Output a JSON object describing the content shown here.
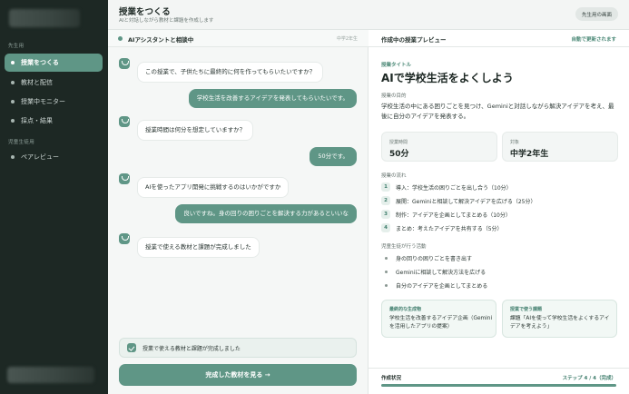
{
  "sidebar": {
    "section_teacher": "先生用",
    "items": [
      {
        "label": "授業をつくる",
        "active": true
      },
      {
        "label": "教材と配信"
      },
      {
        "label": "授業中モニター"
      },
      {
        "label": "採点・結果"
      }
    ],
    "section_student": "児童生徒用",
    "student_items": [
      {
        "label": "ペアレビュー"
      }
    ]
  },
  "header": {
    "title": "授業をつくる",
    "subtitle": "AIと対話しながら教材と課題を作成します",
    "button": "先生用の画面"
  },
  "chat": {
    "title": "AIアシスタントと相談中",
    "meta": "中学2年生",
    "messages": [
      {
        "role": "ai",
        "text": "この授業で、子供たちに最終的に何を作ってもらいたいですか？"
      },
      {
        "role": "user",
        "text": "学校生活を改善するアイデアを発表してもらいたいです。"
      },
      {
        "role": "ai",
        "text": "授業時間は何分を想定していますか？"
      },
      {
        "role": "user",
        "text": "50分です。"
      },
      {
        "role": "ai",
        "text": "AIを使ったアプリ開発に挑戦するのはいかがですか"
      },
      {
        "role": "user",
        "text": "良いですね。身の回りの困りごとを解決する力があるといいな"
      },
      {
        "role": "ai",
        "text": "授業で使える教材と課題が完成しました"
      }
    ],
    "notice": "授業で使える教材と課題が完成しました",
    "cta": "完成した教材を見る →"
  },
  "preview": {
    "title": "作成中の授業プレビュー",
    "auto_save": "自動で更新されます",
    "lesson_title_label": "授業タイトル",
    "lesson_title": "AIで学校生活をよくしよう",
    "goal_label": "授業の目的",
    "goal": "学校生活の中にある困りごとを見つけ、Geminiと対話しながら解決アイデアを考え、最後に自分のアイデアを発表する。",
    "stats": [
      {
        "label": "授業時間",
        "value": "50分"
      },
      {
        "label": "対象",
        "value": "中学2年生"
      }
    ],
    "flow_label": "授業の流れ",
    "flow": [
      {
        "num": "1",
        "text": "導入：学校生活の困りごとを出し合う（10分）"
      },
      {
        "num": "2",
        "text": "展開：Geminiと相談して解決アイデアを広げる（25分）"
      },
      {
        "num": "3",
        "text": "制作：アイデアを企画としてまとめる（10分）"
      },
      {
        "num": "4",
        "text": "まとめ：考えたアイデアを共有する（5分）"
      }
    ],
    "activities_label": "児童生徒が行う活動",
    "activities": [
      "身の回りの困りごとを書き出す",
      "Geminiに相談して解決方法を広げる",
      "自分のアイデアを企画としてまとめる"
    ],
    "cards": [
      {
        "label": "最終的な生成物",
        "text": "学校生活を改善するアイデア企画（Geminiを活用したアプリの提案）"
      },
      {
        "label": "授業で使う課題",
        "text": "課題「AIを使って学校生活をよくするアイデアを考えよう」"
      }
    ],
    "progress": {
      "label": "作成状況",
      "status": "ステップ 4 / 4（完成）",
      "fraction": 1.0
    }
  },
  "colors": {
    "accent": "#5f9686",
    "sidebar_bg": "#1d2824"
  }
}
